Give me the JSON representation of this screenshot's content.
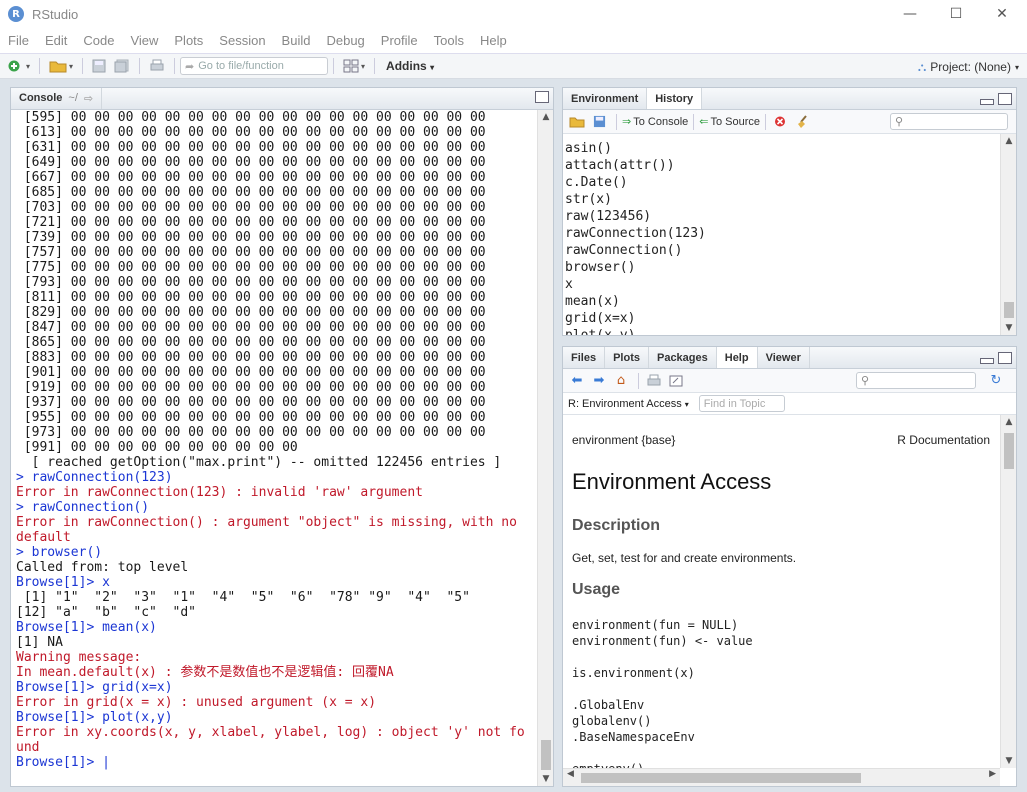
{
  "app": {
    "title": "RStudio",
    "logo_letter": "R"
  },
  "window_controls": {
    "minimize": "—",
    "maximize": "☐",
    "close": "✕"
  },
  "menu": [
    "File",
    "Edit",
    "Code",
    "View",
    "Plots",
    "Session",
    "Build",
    "Debug",
    "Profile",
    "Tools",
    "Help"
  ],
  "toolbar": {
    "goto_placeholder": "Go to file/function",
    "addins_label": "Addins",
    "project_label": "Project: (None)"
  },
  "console": {
    "tab_label": "Console",
    "path": "~/",
    "lines": [
      {
        "t": "out",
        "s": " [595] 00 00 00 00 00 00 00 00 00 00 00 00 00 00 00 00 00 00"
      },
      {
        "t": "out",
        "s": " [613] 00 00 00 00 00 00 00 00 00 00 00 00 00 00 00 00 00 00"
      },
      {
        "t": "out",
        "s": " [631] 00 00 00 00 00 00 00 00 00 00 00 00 00 00 00 00 00 00"
      },
      {
        "t": "out",
        "s": " [649] 00 00 00 00 00 00 00 00 00 00 00 00 00 00 00 00 00 00"
      },
      {
        "t": "out",
        "s": " [667] 00 00 00 00 00 00 00 00 00 00 00 00 00 00 00 00 00 00"
      },
      {
        "t": "out",
        "s": " [685] 00 00 00 00 00 00 00 00 00 00 00 00 00 00 00 00 00 00"
      },
      {
        "t": "out",
        "s": " [703] 00 00 00 00 00 00 00 00 00 00 00 00 00 00 00 00 00 00"
      },
      {
        "t": "out",
        "s": " [721] 00 00 00 00 00 00 00 00 00 00 00 00 00 00 00 00 00 00"
      },
      {
        "t": "out",
        "s": " [739] 00 00 00 00 00 00 00 00 00 00 00 00 00 00 00 00 00 00"
      },
      {
        "t": "out",
        "s": " [757] 00 00 00 00 00 00 00 00 00 00 00 00 00 00 00 00 00 00"
      },
      {
        "t": "out",
        "s": " [775] 00 00 00 00 00 00 00 00 00 00 00 00 00 00 00 00 00 00"
      },
      {
        "t": "out",
        "s": " [793] 00 00 00 00 00 00 00 00 00 00 00 00 00 00 00 00 00 00"
      },
      {
        "t": "out",
        "s": " [811] 00 00 00 00 00 00 00 00 00 00 00 00 00 00 00 00 00 00"
      },
      {
        "t": "out",
        "s": " [829] 00 00 00 00 00 00 00 00 00 00 00 00 00 00 00 00 00 00"
      },
      {
        "t": "out",
        "s": " [847] 00 00 00 00 00 00 00 00 00 00 00 00 00 00 00 00 00 00"
      },
      {
        "t": "out",
        "s": " [865] 00 00 00 00 00 00 00 00 00 00 00 00 00 00 00 00 00 00"
      },
      {
        "t": "out",
        "s": " [883] 00 00 00 00 00 00 00 00 00 00 00 00 00 00 00 00 00 00"
      },
      {
        "t": "out",
        "s": " [901] 00 00 00 00 00 00 00 00 00 00 00 00 00 00 00 00 00 00"
      },
      {
        "t": "out",
        "s": " [919] 00 00 00 00 00 00 00 00 00 00 00 00 00 00 00 00 00 00"
      },
      {
        "t": "out",
        "s": " [937] 00 00 00 00 00 00 00 00 00 00 00 00 00 00 00 00 00 00"
      },
      {
        "t": "out",
        "s": " [955] 00 00 00 00 00 00 00 00 00 00 00 00 00 00 00 00 00 00"
      },
      {
        "t": "out",
        "s": " [973] 00 00 00 00 00 00 00 00 00 00 00 00 00 00 00 00 00 00"
      },
      {
        "t": "out",
        "s": " [991] 00 00 00 00 00 00 00 00 00 00"
      },
      {
        "t": "out",
        "s": "  [ reached getOption(\"max.print\") -- omitted 122456 entries ]"
      },
      {
        "t": "cmd",
        "s": "> rawConnection(123)"
      },
      {
        "t": "err",
        "s": "Error in rawConnection(123) : invalid 'raw' argument"
      },
      {
        "t": "cmd",
        "s": "> rawConnection()"
      },
      {
        "t": "err",
        "s": "Error in rawConnection() : argument \"object\" is missing, with no"
      },
      {
        "t": "err",
        "s": "default"
      },
      {
        "t": "cmd",
        "s": "> browser()"
      },
      {
        "t": "out",
        "s": "Called from: top level"
      },
      {
        "t": "cmd",
        "s": "Browse[1]> x"
      },
      {
        "t": "out",
        "s": " [1] \"1\"  \"2\"  \"3\"  \"1\"  \"4\"  \"5\"  \"6\"  \"78\" \"9\"  \"4\"  \"5\""
      },
      {
        "t": "out",
        "s": "[12] \"a\"  \"b\"  \"c\"  \"d\""
      },
      {
        "t": "cmd",
        "s": "Browse[1]> mean(x)"
      },
      {
        "t": "out",
        "s": "[1] NA"
      },
      {
        "t": "err",
        "s": "Warning message:"
      },
      {
        "t": "err",
        "s": "In mean.default(x) : 参数不是数值也不是逻辑值: 回覆NA"
      },
      {
        "t": "cmd",
        "s": "Browse[1]> grid(x=x)"
      },
      {
        "t": "err",
        "s": "Error in grid(x = x) : unused argument (x = x)"
      },
      {
        "t": "cmd",
        "s": "Browse[1]> plot(x,y)"
      },
      {
        "t": "err",
        "s": "Error in xy.coords(x, y, xlabel, ylabel, log) : object 'y' not fo"
      },
      {
        "t": "err",
        "s": "und"
      },
      {
        "t": "cmd",
        "s": "Browse[1]> "
      }
    ]
  },
  "env_pane": {
    "tabs": [
      "Environment",
      "History"
    ],
    "active_tab": "History",
    "to_console": "To Console",
    "to_source": "To Source",
    "history": [
      "asin()",
      "attach(attr())",
      "c.Date()",
      "str(x)",
      "raw(123456)",
      "rawConnection(123)",
      "rawConnection()",
      "browser()",
      "x",
      "mean(x)",
      "grid(x=x)",
      "plot(x,y)"
    ]
  },
  "files_pane": {
    "tabs": [
      "Files",
      "Plots",
      "Packages",
      "Help",
      "Viewer"
    ],
    "active_tab": "Help",
    "topic_select": "R: Environment Access",
    "find_placeholder": "Find in Topic",
    "doc": {
      "left_header": "environment {base}",
      "right_header": "R Documentation",
      "title": "Environment Access",
      "desc_heading": "Description",
      "desc_text": "Get, set, test for and create environments.",
      "usage_heading": "Usage",
      "usage_code": [
        "environment(fun = NULL)",
        "environment(fun) <- value",
        "",
        "is.environment(x)",
        "",
        ".GlobalEnv",
        "globalenv()",
        ".BaseNamespaceEnv",
        "",
        "emptyenv()"
      ]
    }
  },
  "colors": {
    "prompt": "#1b36d4",
    "error": "#c0192a",
    "output": "#1a1a1a"
  }
}
